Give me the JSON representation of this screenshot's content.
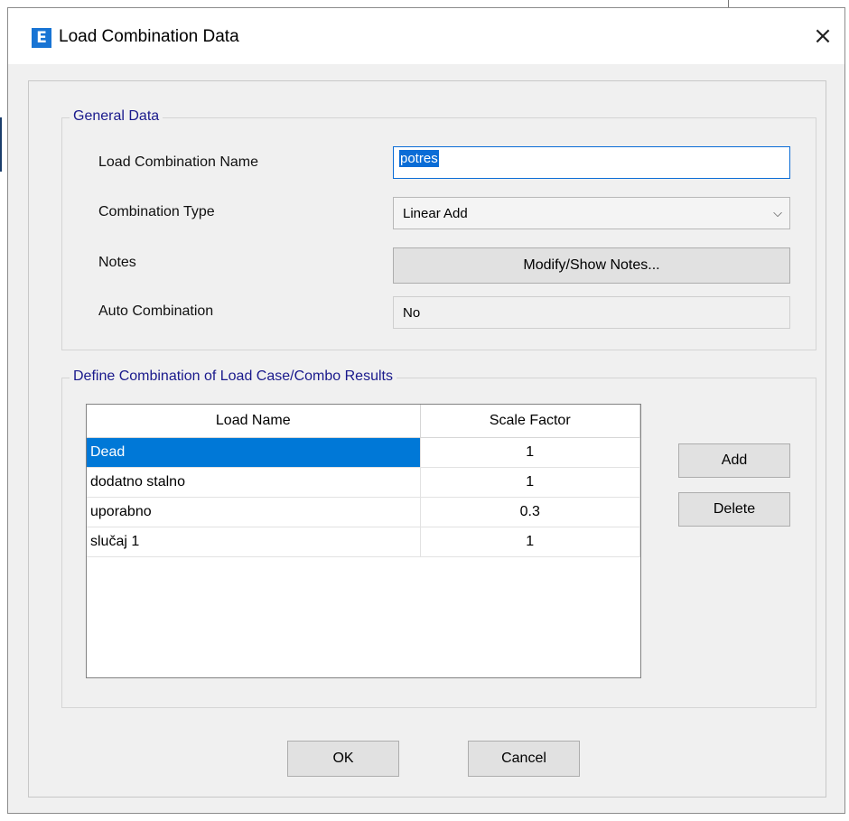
{
  "window": {
    "title": "Load Combination Data",
    "app_icon_letter": "E",
    "close_glyph": "×"
  },
  "general": {
    "legend": "General Data",
    "name_label": "Load Combination Name",
    "name_value": "potres",
    "type_label": "Combination Type",
    "type_value": "Linear Add",
    "notes_label": "Notes",
    "notes_button": "Modify/Show Notes...",
    "auto_label": "Auto Combination",
    "auto_value": "No"
  },
  "define": {
    "legend": "Define Combination of Load Case/Combo Results",
    "columns": [
      "Load Name",
      "Scale Factor"
    ],
    "rows": [
      {
        "name": "Dead",
        "factor": "1"
      },
      {
        "name": "dodatno stalno",
        "factor": "1"
      },
      {
        "name": "uporabno",
        "factor": "0.3"
      },
      {
        "name": "slučaj 1",
        "factor": "1"
      }
    ],
    "selected_row": 0,
    "add_button": "Add",
    "delete_button": "Delete"
  },
  "footer": {
    "ok_button": "OK",
    "cancel_button": "Cancel"
  },
  "colors": {
    "accent": "#0078d7",
    "legend_text": "#1a1a8c",
    "dialog_bg": "#f0f0f0"
  },
  "icons": {
    "app": "etabs-app-icon",
    "close": "close-icon",
    "dropdown": "chevron-down-icon"
  }
}
